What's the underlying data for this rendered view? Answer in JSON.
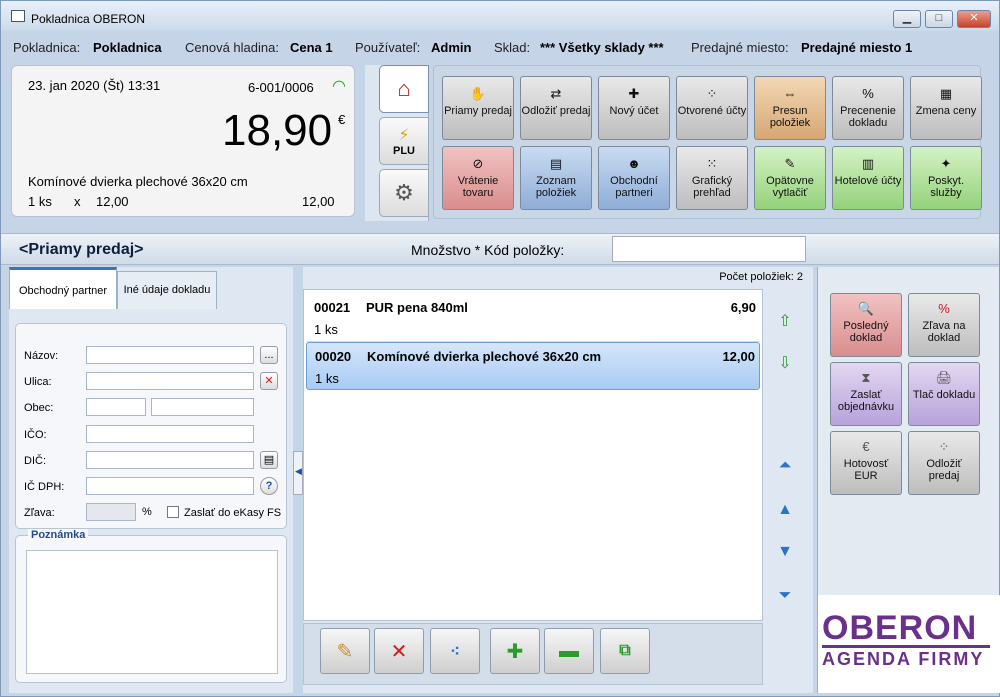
{
  "window": {
    "title": "Pokladnica OBERON",
    "minimize": "▁",
    "maximize": "□",
    "close": "✕"
  },
  "infobar": {
    "cash_label": "Pokladnica:",
    "cash_value": "Pokladnica",
    "price_label": "Cenová hladina:",
    "price_value": "Cena 1",
    "user_label": "Používateľ:",
    "user_value": "Admin",
    "store_label": "Sklad:",
    "store_value": "*** Všetky sklady ***",
    "sale_label": "Predajné miesto:",
    "sale_value": "Predajné miesto 1"
  },
  "register": {
    "datetime": "23. jan 2020 (Št)  13:31",
    "doc_no": "6-001/0006",
    "total": "18,90",
    "currency": "€",
    "item_name": "Komínové dvierka plechové 36x20 cm",
    "item_qty": "1  ks",
    "item_x": "x",
    "item_price": "12,00",
    "item_total": "12,00"
  },
  "vtabs": {
    "plu": "PLU"
  },
  "func_buttons": [
    {
      "label": "Priamy predaj",
      "icon": "hand-icon",
      "color": "g"
    },
    {
      "label": "Odložiť predaj",
      "icon": "park-icon",
      "color": "g"
    },
    {
      "label": "Nový účet",
      "icon": "new-account-icon",
      "color": "g"
    },
    {
      "label": "Otvorené účty",
      "icon": "open-accounts-icon",
      "color": "g"
    },
    {
      "label": "Presun položiek",
      "icon": "move-items-icon",
      "color": "or"
    },
    {
      "label": "Precenenie dokladu",
      "icon": "reprice-icon",
      "color": "g"
    },
    {
      "label": "Zmena ceny",
      "icon": "price-change-icon",
      "color": "g"
    },
    {
      "label": "Vrátenie tovaru",
      "icon": "return-icon",
      "color": "rd"
    },
    {
      "label": "Zoznam položiek",
      "icon": "item-list-icon",
      "color": "bl"
    },
    {
      "label": "Obchodní partneri",
      "icon": "partners-icon",
      "color": "bl"
    },
    {
      "label": "Grafický prehľad",
      "icon": "graph-view-icon",
      "color": "g"
    },
    {
      "label": "Opätovne vytlačiť",
      "icon": "reprint-icon",
      "color": "gr"
    },
    {
      "label": "Hotelové účty",
      "icon": "hotel-icon",
      "color": "gr"
    },
    {
      "label": "Poskyt. služby",
      "icon": "services-icon",
      "color": "gr"
    }
  ],
  "mode": {
    "title": "<Priamy predaj>",
    "qty_label": "Množstvo * Kód položky:",
    "qty_value": ""
  },
  "partner": {
    "tab1": "Obchodný partner",
    "tab2": "Iné údaje dokladu",
    "name_label": "Názov:",
    "street_label": "Ulica:",
    "city_label": "Obec:",
    "ico_label": "IČO:",
    "dic_label": "DIČ:",
    "icdph_label": "IČ DPH:",
    "discount_label": "Zľava:",
    "percent": "%",
    "ekasa_label": "Zaslať do eKasy FS",
    "browse": "...",
    "help": "?",
    "note_label": "Poznámka"
  },
  "items": {
    "count_label": "Počet položiek: 2",
    "rows": [
      {
        "code": "00021",
        "name": "PUR pena 840ml",
        "qty": "1  ks",
        "price": "6,90"
      },
      {
        "code": "00020",
        "name": "Komínové dvierka plechové 36x20 cm",
        "qty": "1  ks",
        "price": "12,00"
      }
    ]
  },
  "side_buttons": [
    {
      "label": "Posledný doklad",
      "icon": "last-doc-icon",
      "color": "rd",
      "sym": "🔍"
    },
    {
      "label": "Zľava na doklad",
      "icon": "percent-icon",
      "color": "g",
      "sym": "%"
    },
    {
      "label": "Zaslať objednávku",
      "icon": "send-order-icon",
      "color": "pu",
      "sym": "⧗"
    },
    {
      "label": "Tlač dokladu",
      "icon": "print-icon",
      "color": "pu",
      "sym": "🖨"
    },
    {
      "label": "Hotovosť EUR",
      "icon": "cash-icon",
      "color": "g",
      "sym": "€"
    },
    {
      "label": "Odložiť predaj",
      "icon": "park-icon",
      "color": "g",
      "sym": "⁘"
    }
  ],
  "logo": {
    "line1": "OBERON",
    "line2": "AGENDA FIRMY"
  },
  "colors": {
    "accent": "#3f72b8",
    "brand": "#6b2f8c"
  }
}
